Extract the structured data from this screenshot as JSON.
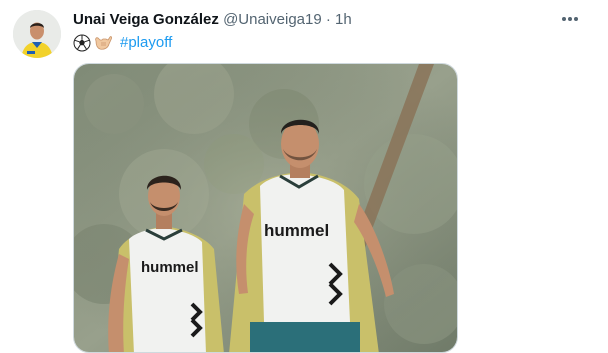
{
  "tweet": {
    "author_name": "Unai Veiga González",
    "handle": "@Unaiveiga19",
    "separator": "·",
    "time": "1h",
    "emojis": [
      "soccer-ball",
      "call-me-hand"
    ],
    "hashtag": "#playoff"
  },
  "media": {
    "vest_text_left": "hummel",
    "vest_text_right": "hummel"
  },
  "colors": {
    "link": "#1d9bf0",
    "secondary_text": "#536471",
    "vest": "#f1f2f0",
    "shirt": "#c9c06a"
  },
  "icons": {
    "more": "more-horizontal-icon"
  }
}
